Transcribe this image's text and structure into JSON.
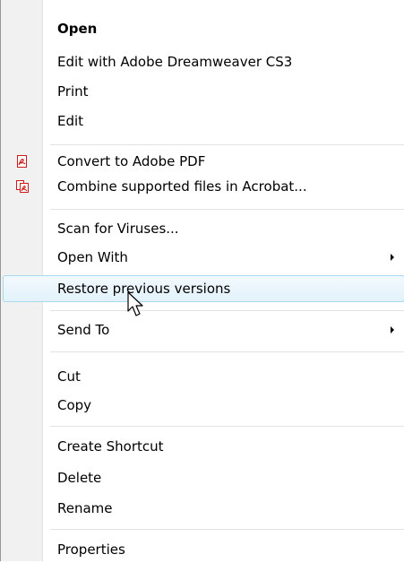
{
  "menu": {
    "items": [
      {
        "label": "Open"
      },
      {
        "label": "Edit with Adobe Dreamweaver CS3"
      },
      {
        "label": "Print"
      },
      {
        "label": "Edit"
      },
      {
        "label": "Convert to Adobe PDF",
        "icon": "pdf-convert-icon"
      },
      {
        "label": "Combine supported files in Acrobat...",
        "icon": "pdf-combine-icon"
      },
      {
        "label": "Scan for Viruses..."
      },
      {
        "label": "Open With",
        "submenu": true
      },
      {
        "label": "Restore previous versions",
        "highlighted": true
      },
      {
        "label": "Send To",
        "submenu": true
      },
      {
        "label": "Cut"
      },
      {
        "label": "Copy"
      },
      {
        "label": "Create Shortcut"
      },
      {
        "label": "Delete"
      },
      {
        "label": "Rename"
      },
      {
        "label": "Properties"
      }
    ],
    "colors": {
      "highlight_border": "#a8d8eb",
      "highlight_fill": "#e2f2fb",
      "gutter": "#f1f1f1",
      "pdf_red": "#cc1b1b"
    }
  }
}
